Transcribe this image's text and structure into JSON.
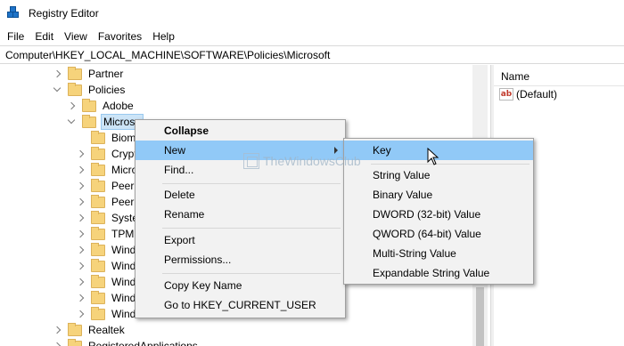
{
  "window": {
    "title": "Registry Editor"
  },
  "menubar": [
    "File",
    "Edit",
    "View",
    "Favorites",
    "Help"
  ],
  "address": "Computer\\HKEY_LOCAL_MACHINE\\SOFTWARE\\Policies\\Microsoft",
  "tree": {
    "partner": "Partner",
    "policies": "Policies",
    "adobe": "Adobe",
    "microsoft": "Microso",
    "children": [
      "Biom",
      "Crypt",
      "Micro",
      "PeerD",
      "Peern",
      "Syste",
      "TPM",
      "Wind",
      "Wind",
      "Wind",
      "Wind",
      "Wind"
    ],
    "realtek": "Realtek",
    "registered": "RegisteredApplications"
  },
  "rightpane": {
    "column_name": "Name",
    "icon": "ab",
    "values": [
      "(Default)"
    ]
  },
  "context_menu": {
    "collapse": "Collapse",
    "new": "New",
    "find": "Find...",
    "delete": "Delete",
    "rename": "Rename",
    "export": "Export",
    "permissions": "Permissions...",
    "copy_key_name": "Copy Key Name",
    "goto": "Go to HKEY_CURRENT_USER"
  },
  "submenu": {
    "key": "Key",
    "string_value": "String Value",
    "binary_value": "Binary Value",
    "dword": "DWORD (32-bit) Value",
    "qword": "QWORD (64-bit) Value",
    "multi_string": "Multi-String Value",
    "expandable_string": "Expandable String Value"
  },
  "watermark": "TheWindowsClub",
  "colors": {
    "hover": "#91c9f7",
    "selected": "#cce4f7",
    "folder": "#f6d37b"
  }
}
